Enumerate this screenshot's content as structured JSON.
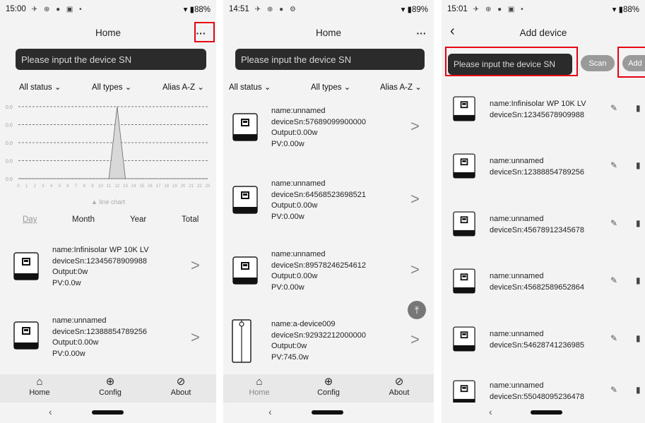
{
  "screen1": {
    "status": {
      "time": "15:00",
      "icons": "✈ ⊕ ● ▣ •",
      "battery": "▾ ▮88%"
    },
    "title": "Home",
    "menu_label": "···",
    "search_placeholder": "Please input the device SN",
    "filters": {
      "status": "All status ⌄",
      "types": "All types ⌄",
      "sort": "Alias A-Z ⌄"
    },
    "chart_data": {
      "type": "area",
      "caption": "▲ line chart",
      "yticks": [
        "0.0",
        "0.0",
        "0.0",
        "0.0",
        "0.0"
      ],
      "x": [
        "0",
        "1",
        "2",
        "3",
        "4",
        "5",
        "6",
        "7",
        "8",
        "9",
        "10",
        "11",
        "12",
        "13",
        "14",
        "15",
        "16",
        "17",
        "18",
        "19",
        "20",
        "21",
        "22",
        "23"
      ],
      "values": [
        0,
        0,
        0,
        0,
        0,
        0,
        0,
        0,
        0,
        0,
        0,
        0,
        1,
        0,
        0,
        0,
        0,
        0,
        0,
        0,
        0,
        0,
        0,
        0
      ],
      "grid": true
    },
    "periods": {
      "day": "Day",
      "month": "Month",
      "year": "Year",
      "total": "Total"
    },
    "devices": [
      {
        "name": "name:Infinisolar WP 10K LV",
        "sn": "deviceSn:12345678909988",
        "output": "Output:0w",
        "pv": "PV:0.0w"
      },
      {
        "name": "name:unnamed",
        "sn": "deviceSn:12388854789256",
        "output": "Output:0.00w",
        "pv": "PV:0.00w"
      }
    ]
  },
  "screen2": {
    "status": {
      "time": "14:51",
      "icons": "✈ ⊕ ● ⚙",
      "battery": "▾ ▮89%"
    },
    "title": "Home",
    "menu_label": "···",
    "search_placeholder": "Please input the device SN",
    "filters": {
      "status": "All status ⌄",
      "types": "All types ⌄",
      "sort": "Alias A-Z ⌄"
    },
    "devices": [
      {
        "name": "name:unnamed",
        "sn": "deviceSn:57689099900000",
        "output": "Output:0.00w",
        "pv": "PV:0.00w"
      },
      {
        "name": "name:unnamed",
        "sn": "deviceSn:64568523698521",
        "output": "Output:0.00w",
        "pv": "PV:0.00w"
      },
      {
        "name": "name:unnamed",
        "sn": "deviceSn:89578246254612",
        "output": "Output:0.00w",
        "pv": "PV:0.00w"
      },
      {
        "name": "name:a-device009",
        "sn": "deviceSn:92932212000000",
        "output": "Output:0w",
        "pv": "PV:745.0w"
      }
    ]
  },
  "screen3": {
    "status": {
      "time": "15:01",
      "icons": "✈ ⊕ ● ▣ •",
      "battery": "▾ ▮88%"
    },
    "title": "Add device",
    "back_label": "‹",
    "search_placeholder": "Please input the device SN",
    "scan_label": "Scan",
    "add_label": "Add",
    "devices": [
      {
        "name": "name:Infinisolar WP 10K LV",
        "sn": "deviceSn:12345678909988"
      },
      {
        "name": "name:unnamed",
        "sn": "deviceSn:12388854789256"
      },
      {
        "name": "name:unnamed",
        "sn": "deviceSn:45678912345678"
      },
      {
        "name": "name:unnamed",
        "sn": "deviceSn:45682589652864"
      },
      {
        "name": "name:unnamed",
        "sn": "deviceSn:54628741236985"
      },
      {
        "name": "name:unnamed",
        "sn": "deviceSn:55048095236478"
      }
    ]
  },
  "tabs": {
    "home": "Home",
    "config": "Config",
    "about": "About"
  },
  "nav": {
    "back": "‹"
  },
  "colors": {
    "highlight": "#e60012",
    "search_bg": "#2b2b2b",
    "tabbar_bg": "#e8e8e8"
  }
}
